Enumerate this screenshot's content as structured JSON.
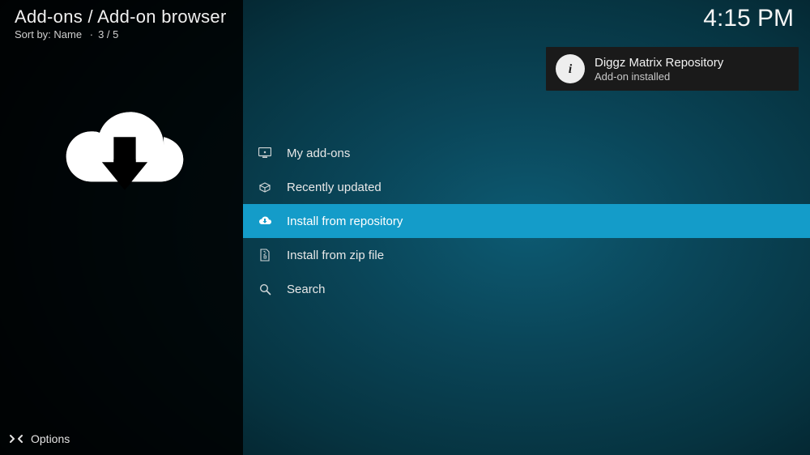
{
  "header": {
    "breadcrumb": "Add-ons / Add-on browser",
    "sort_label": "Sort by:",
    "sort_value": "Name",
    "position": "3 / 5"
  },
  "clock": "4:15 PM",
  "menu": {
    "items": [
      {
        "icon": "monitor-icon",
        "label": "My add-ons",
        "selected": false
      },
      {
        "icon": "open-box-icon",
        "label": "Recently updated",
        "selected": false
      },
      {
        "icon": "cloud-download-icon",
        "label": "Install from repository",
        "selected": true
      },
      {
        "icon": "zip-file-icon",
        "label": "Install from zip file",
        "selected": false
      },
      {
        "icon": "search-icon",
        "label": "Search",
        "selected": false
      }
    ]
  },
  "notification": {
    "title": "Diggz Matrix Repository",
    "subtitle": "Add-on installed"
  },
  "footer": {
    "options_label": "Options"
  }
}
